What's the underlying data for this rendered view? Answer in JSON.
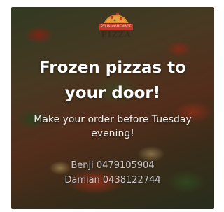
{
  "logo": {
    "ribbon_text": "RYLIN HOMEMADE",
    "word": "PIZZA",
    "colors": {
      "ribbon": "#c0392b",
      "slice": "#e9a23b",
      "crust": "#d98a2b"
    }
  },
  "headline": {
    "line1": "Frozen pizzas to",
    "line2": "your door!"
  },
  "subtext": {
    "line1": "Make your order before Tuesday",
    "line2": "evening!"
  },
  "contacts": [
    {
      "text": "Benji 0479105904"
    },
    {
      "text": "Damian 0438122744"
    }
  ],
  "background": "pizza photo"
}
